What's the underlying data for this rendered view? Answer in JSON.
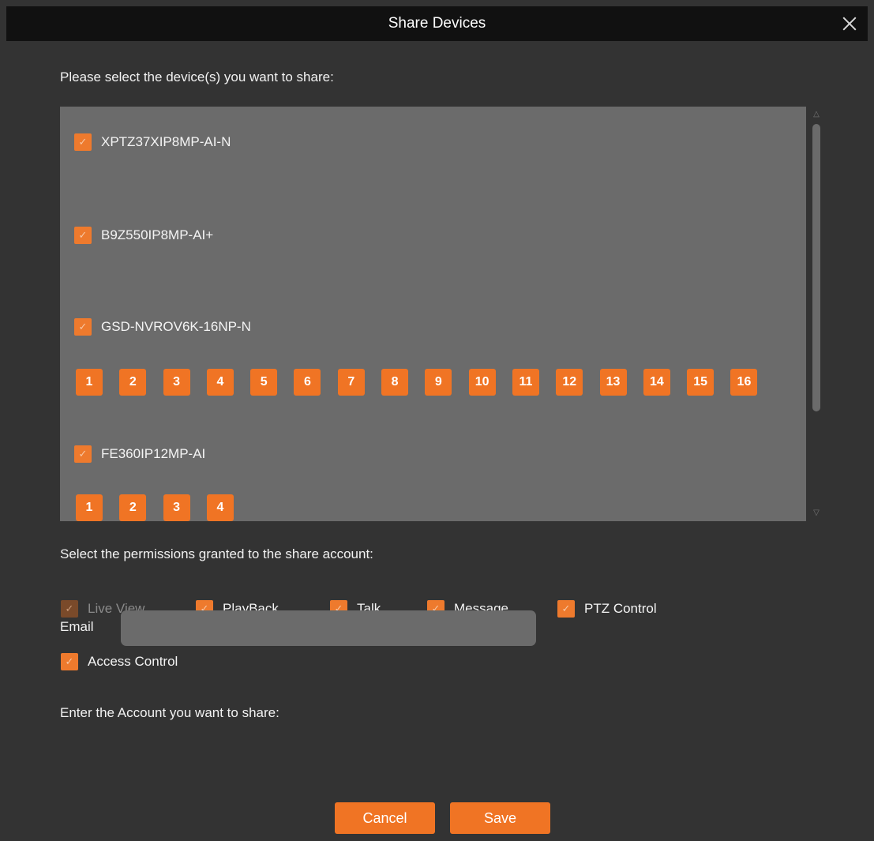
{
  "dialog": {
    "title": "Share Devices",
    "close_icon": "close-icon"
  },
  "devices_section": {
    "prompt": "Please select the device(s) you want to share:",
    "devices": [
      {
        "name": "XPTZ37XIP8MP-AI-N",
        "checked": true,
        "channels": []
      },
      {
        "name": "B9Z550IP8MP-AI+",
        "checked": true,
        "channels": []
      },
      {
        "name": "GSD-NVROV6K-16NP-N",
        "checked": true,
        "channels": [
          "1",
          "2",
          "3",
          "4",
          "5",
          "6",
          "7",
          "8",
          "9",
          "10",
          "11",
          "12",
          "13",
          "14",
          "15",
          "16"
        ]
      },
      {
        "name": "FE360IP12MP-AI",
        "checked": true,
        "channels": [
          "1",
          "2",
          "3",
          "4"
        ]
      }
    ],
    "checkmark": "✓"
  },
  "permissions_section": {
    "prompt": "Select the permissions granted to the share account:",
    "permissions": [
      {
        "label": "Live View",
        "checked": true,
        "disabled": true
      },
      {
        "label": "PlayBack",
        "checked": true,
        "disabled": false
      },
      {
        "label": "Talk",
        "checked": true,
        "disabled": false
      },
      {
        "label": "Message",
        "checked": true,
        "disabled": false
      },
      {
        "label": "PTZ Control",
        "checked": true,
        "disabled": false
      },
      {
        "label": "Access Control",
        "checked": true,
        "disabled": false
      }
    ]
  },
  "account_section": {
    "prompt": "Enter the Account you want to share:",
    "email_label": "Email",
    "email_value": "",
    "email_placeholder": ""
  },
  "actions": {
    "cancel_label": "Cancel",
    "save_label": "Save"
  },
  "colors": {
    "accent": "#f07424",
    "background": "#333333",
    "titlebar": "#111111",
    "panel": "#6b6b6b"
  }
}
